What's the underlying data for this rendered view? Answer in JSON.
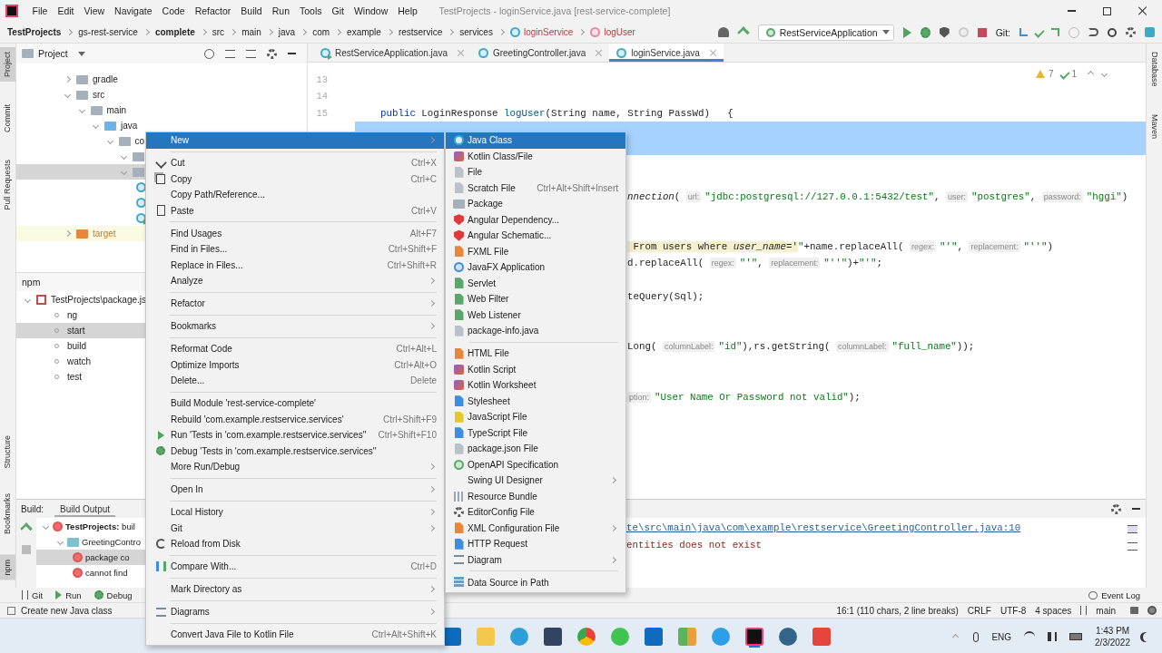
{
  "window": {
    "menu": [
      "File",
      "Edit",
      "View",
      "Navigate",
      "Code",
      "Refactor",
      "Build",
      "Run",
      "Tools",
      "Git",
      "Window",
      "Help"
    ],
    "title": "TestProjects - loginService.java [rest-service-complete]"
  },
  "breadcrumbs": [
    {
      "label": "TestProjects",
      "kind": "project"
    },
    {
      "label": "gs-rest-service",
      "kind": "dir"
    },
    {
      "label": "complete",
      "kind": "module"
    },
    {
      "label": "src",
      "kind": "dir"
    },
    {
      "label": "main",
      "kind": "dir"
    },
    {
      "label": "java",
      "kind": "dir"
    },
    {
      "label": "com",
      "kind": "dir"
    },
    {
      "label": "example",
      "kind": "dir"
    },
    {
      "label": "restservice",
      "kind": "dir"
    },
    {
      "label": "services",
      "kind": "dir"
    },
    {
      "label": "loginService",
      "kind": "class"
    },
    {
      "label": "logUser",
      "kind": "method"
    }
  ],
  "toolbar": {
    "run_config": "RestServiceApplication",
    "git_label": "Git:"
  },
  "left_strip": {
    "top": [
      {
        "label": "Project",
        "selected": true
      },
      {
        "label": "Commit",
        "selected": false
      },
      {
        "label": "Pull Requests",
        "selected": false
      }
    ],
    "bottom": [
      {
        "label": "Structure",
        "selected": false
      },
      {
        "label": "Bookmarks",
        "selected": false
      },
      {
        "label": "npm",
        "selected": true
      }
    ]
  },
  "right_strip": [
    {
      "label": "Database",
      "selected": false
    },
    {
      "label": "Maven",
      "selected": false
    }
  ],
  "project_panel": {
    "title": "Project",
    "tree": [
      {
        "label": "gradle",
        "kind": "folder",
        "expanded": false,
        "selected": false
      },
      {
        "label": "src",
        "kind": "folder",
        "expanded": true,
        "selected": false,
        "children": [
          {
            "label": "main",
            "kind": "folder",
            "expanded": true,
            "selected": false,
            "children": [
              {
                "label": "java",
                "kind": "source",
                "expanded": true,
                "selected": false,
                "children": [
                  {
                    "label": "co",
                    "kind": "folder",
                    "expanded": true,
                    "selected": false,
                    "children": [
                      {
                        "kind": "folder",
                        "expanded": true,
                        "selected": false
                      },
                      {
                        "kind": "folder",
                        "expanded": true,
                        "selected": true,
                        "children": [
                          {
                            "kind": "class",
                            "selected": false
                          },
                          {
                            "kind": "class",
                            "selected": false
                          },
                          {
                            "kind": "runnable",
                            "selected": false
                          }
                        ]
                      }
                    ]
                  }
                ]
              }
            ]
          }
        ]
      },
      {
        "label": "target",
        "kind": "excluded",
        "expanded": false,
        "selected": false
      }
    ]
  },
  "npm_panel": {
    "title": "npm",
    "tree": [
      {
        "label": "TestProjects\\package.js",
        "kind": "package",
        "expanded": true,
        "selected": false,
        "children": [
          {
            "label": "ng",
            "kind": "script",
            "selected": false
          },
          {
            "label": "start",
            "kind": "script",
            "selected": true
          },
          {
            "label": "build",
            "kind": "script",
            "selected": false
          },
          {
            "label": "watch",
            "kind": "script",
            "selected": false
          },
          {
            "label": "test",
            "kind": "script",
            "selected": false
          }
        ]
      }
    ]
  },
  "editor": {
    "tabs": [
      {
        "label": "RestServiceApplication.java",
        "kind": "runnable",
        "selected": false
      },
      {
        "label": "GreetingController.java",
        "kind": "class",
        "selected": false
      },
      {
        "label": "loginService.java",
        "kind": "class",
        "selected": true
      }
    ],
    "inspections": {
      "warnings": "7",
      "weak_warnings": "1"
    },
    "gutter": [
      "13",
      "14",
      "15"
    ],
    "lines": [
      {
        "kind": "blank",
        "selected": false
      },
      {
        "kind": "blank",
        "selected": false
      },
      {
        "kind": "whole",
        "selected": false,
        "segments": [
          {
            "kind": "keyword",
            "text": "public"
          },
          {
            "kind": "plain",
            "text": " LoginResponse "
          },
          {
            "kind": "method",
            "text": "logUser"
          },
          {
            "kind": "plain",
            "text": "(String name, String PassWd)   {"
          }
        ]
      },
      {
        "kind": "tail",
        "selected": true
      },
      {
        "kind": "tail",
        "selected": true
      },
      {
        "kind": "blank",
        "selected": false
      },
      {
        "kind": "blank",
        "selected": false
      },
      {
        "kind": "tail",
        "selected": false,
        "segments": [
          {
            "kind": "static",
            "text": "nnection"
          },
          {
            "kind": "plain",
            "text": "( "
          },
          {
            "kind": "hint",
            "text": "url:"
          },
          {
            "kind": "string",
            "text": "\"jdbc:postgresql://127.0.0.1:5432/test\""
          },
          {
            "kind": "plain",
            "text": ", "
          },
          {
            "kind": "hint",
            "text": "user:"
          },
          {
            "kind": "string",
            "text": "\"postgres\""
          },
          {
            "kind": "plain",
            "text": ", "
          },
          {
            "kind": "hint",
            "text": "password:"
          },
          {
            "kind": "string",
            "text": "\"hggi\""
          },
          {
            "kind": "plain",
            "text": ")"
          }
        ]
      },
      {
        "kind": "blank",
        "selected": false
      },
      {
        "kind": "blank",
        "selected": false
      },
      {
        "kind": "tail",
        "selected": false,
        "segments": [
          {
            "kind": "sql",
            "text": " From users where "
          },
          {
            "kind": "sql-italic",
            "text": "user_name="
          },
          {
            "kind": "sql",
            "text": "'"
          },
          {
            "kind": "string",
            "text": "\""
          },
          {
            "kind": "plain",
            "text": "+name.replaceAll( "
          },
          {
            "kind": "hint",
            "text": "regex:"
          },
          {
            "kind": "string",
            "text": "\"'\""
          },
          {
            "kind": "plain",
            "text": ", "
          },
          {
            "kind": "hint",
            "text": "replacement:"
          },
          {
            "kind": "string",
            "text": "\"''\""
          },
          {
            "kind": "plain",
            "text": ")"
          }
        ]
      },
      {
        "kind": "tail",
        "selected": false,
        "segments": [
          {
            "kind": "plain",
            "text": "d.replaceAll( "
          },
          {
            "kind": "hint",
            "text": "regex:"
          },
          {
            "kind": "string",
            "text": "\"'\""
          },
          {
            "kind": "plain",
            "text": ", "
          },
          {
            "kind": "hint",
            "text": "replacement:"
          },
          {
            "kind": "string",
            "text": "\"''\""
          },
          {
            "kind": "plain",
            "text": ")+"
          },
          {
            "kind": "string",
            "text": "\"'\""
          },
          {
            "kind": "plain",
            "text": ";"
          }
        ]
      },
      {
        "kind": "blank",
        "selected": false
      },
      {
        "kind": "tail",
        "selected": false,
        "segments": [
          {
            "kind": "plain",
            "text": "teQuery(Sql);"
          }
        ]
      },
      {
        "kind": "blank",
        "selected": false
      },
      {
        "kind": "blank",
        "selected": false
      },
      {
        "kind": "tail",
        "selected": false,
        "segments": [
          {
            "kind": "plain",
            "text": "Long( "
          },
          {
            "kind": "hint",
            "text": "columnLabel:"
          },
          {
            "kind": "string",
            "text": "\"id\""
          },
          {
            "kind": "plain",
            "text": "),rs.getString( "
          },
          {
            "kind": "hint",
            "text": "columnLabel:"
          },
          {
            "kind": "string",
            "text": "\"full_name\""
          },
          {
            "kind": "plain",
            "text": "));"
          }
        ]
      },
      {
        "kind": "blank",
        "selected": false
      },
      {
        "kind": "blank",
        "selected": false
      },
      {
        "kind": "tail",
        "selected": false,
        "segments": [
          {
            "kind": "hint",
            "text": "ption:"
          },
          {
            "kind": "string",
            "text": "\"User Name Or Password not valid\""
          },
          {
            "kind": "plain",
            "text": ");"
          }
        ]
      }
    ]
  },
  "build_panel": {
    "label": "Build:",
    "tabs": [
      {
        "label": "Build Output",
        "selected": true
      }
    ],
    "tree": [
      {
        "label": "**TestProjects:** buil",
        "kind": "error",
        "expanded": true,
        "selected": false,
        "children": [
          {
            "label": "GreetingContro",
            "kind": "module",
            "expanded": true,
            "selected": false,
            "children": [
              {
                "label": "package co",
                "kind": "error",
                "selected": true
              },
              {
                "label": "cannot find",
                "kind": "error",
                "selected": false
              }
            ]
          }
        ]
      }
    ],
    "output": [
      {
        "kind": "link",
        "text": "te\\src\\main\\java\\com\\example\\restservice\\GreetingController.java:10"
      },
      {
        "kind": "error",
        "text": "entities does not exist"
      }
    ]
  },
  "bottom_tabs": [
    {
      "label": "Git",
      "kind": "git"
    },
    {
      "label": "Run",
      "kind": "run"
    },
    {
      "label": "Debug",
      "kind": "debug"
    }
  ],
  "event_log": "Event Log",
  "status_bar": {
    "message": "Create new Java class",
    "position": "16:1 (110 chars, 2 line breaks)",
    "line_separator": "CRLF",
    "encoding": "UTF-8",
    "indent": "4 spaces",
    "branch": "main"
  },
  "taskbar": {
    "language": "ENG",
    "time": "1:43 PM",
    "date": "2/3/2022"
  },
  "context_menu": {
    "groups": [
      [
        {
          "label": "New",
          "submenu": true,
          "selected": true
        }
      ],
      [
        {
          "label": "Cut",
          "shortcut": "Ctrl+X",
          "submenu": false,
          "selected": false
        },
        {
          "label": "Copy",
          "shortcut": "Ctrl+C",
          "submenu": false,
          "selected": false
        },
        {
          "label": "Copy Path/Reference...",
          "submenu": false,
          "selected": false
        },
        {
          "label": "Paste",
          "shortcut": "Ctrl+V",
          "submenu": false,
          "selected": false
        }
      ],
      [
        {
          "label": "Find Usages",
          "shortcut": "Alt+F7",
          "submenu": false,
          "selected": false
        },
        {
          "label": "Find in Files...",
          "shortcut": "Ctrl+Shift+F",
          "submenu": false,
          "selected": false
        },
        {
          "label": "Replace in Files...",
          "shortcut": "Ctrl+Shift+R",
          "submenu": false,
          "selected": false
        },
        {
          "label": "Analyze",
          "submenu": true,
          "selected": false
        }
      ],
      [
        {
          "label": "Refactor",
          "submenu": true,
          "selected": false
        }
      ],
      [
        {
          "label": "Bookmarks",
          "submenu": true,
          "selected": false
        }
      ],
      [
        {
          "label": "Reformat Code",
          "shortcut": "Ctrl+Alt+L",
          "submenu": false,
          "selected": false
        },
        {
          "label": "Optimize Imports",
          "shortcut": "Ctrl+Alt+O",
          "submenu": false,
          "selected": false
        },
        {
          "label": "Delete...",
          "shortcut": "Delete",
          "submenu": false,
          "selected": false
        }
      ],
      [
        {
          "label": "Build Module 'rest-service-complete'",
          "submenu": false,
          "selected": false
        },
        {
          "label": "Rebuild 'com.example.restservice.services'",
          "shortcut": "Ctrl+Shift+F9",
          "submenu": false,
          "selected": false
        },
        {
          "label": "Run 'Tests in 'com.example.restservice.services''",
          "shortcut": "Ctrl+Shift+F10",
          "submenu": false,
          "selected": false
        },
        {
          "label": "Debug 'Tests in 'com.example.restservice.services''",
          "submenu": false,
          "selected": false
        },
        {
          "label": "More Run/Debug",
          "submenu": true,
          "selected": false
        }
      ],
      [
        {
          "label": "Open In",
          "submenu": true,
          "selected": false
        }
      ],
      [
        {
          "label": "Local History",
          "submenu": true,
          "selected": false
        },
        {
          "label": "Git",
          "submenu": true,
          "selected": false
        },
        {
          "label": "Reload from Disk",
          "submenu": false,
          "selected": false
        }
      ],
      [
        {
          "label": "Compare With...",
          "shortcut": "Ctrl+D",
          "submenu": false,
          "selected": false
        }
      ],
      [
        {
          "label": "Mark Directory as",
          "submenu": true,
          "selected": false
        }
      ],
      [
        {
          "label": "Diagrams",
          "submenu": true,
          "selected": false
        }
      ],
      [
        {
          "label": "Convert Java File to Kotlin File",
          "shortcut": "Ctrl+Alt+Shift+K",
          "submenu": false,
          "selected": false
        }
      ]
    ]
  },
  "new_submenu": {
    "groups": [
      [
        {
          "label": "Java Class",
          "submenu": false,
          "selected": true
        },
        {
          "label": "Kotlin Class/File",
          "submenu": false,
          "selected": false
        },
        {
          "label": "File",
          "submenu": false,
          "selected": false
        },
        {
          "label": "Scratch File",
          "shortcut": "Ctrl+Alt+Shift+Insert",
          "submenu": false,
          "selected": false
        },
        {
          "label": "Package",
          "submenu": false,
          "selected": false
        },
        {
          "label": "Angular Dependency...",
          "submenu": false,
          "selected": false
        },
        {
          "label": "Angular Schematic...",
          "submenu": false,
          "selected": false
        },
        {
          "label": "FXML File",
          "submenu": false,
          "selected": false
        },
        {
          "label": "JavaFX Application",
          "submenu": false,
          "selected": false
        },
        {
          "label": "Servlet",
          "submenu": false,
          "selected": false
        },
        {
          "label": "Web Filter",
          "submenu": false,
          "selected": false
        },
        {
          "label": "Web Listener",
          "submenu": false,
          "selected": false
        },
        {
          "label": "package-info.java",
          "submenu": false,
          "selected": false
        }
      ],
      [
        {
          "label": "HTML File",
          "submenu": false,
          "selected": false
        },
        {
          "label": "Kotlin Script",
          "submenu": false,
          "selected": false
        },
        {
          "label": "Kotlin Worksheet",
          "submenu": false,
          "selected": false
        },
        {
          "label": "Stylesheet",
          "submenu": false,
          "selected": false
        },
        {
          "label": "JavaScript File",
          "submenu": false,
          "selected": false
        },
        {
          "label": "TypeScript File",
          "submenu": false,
          "selected": false
        },
        {
          "label": "package.json File",
          "submenu": false,
          "selected": false
        },
        {
          "label": "OpenAPI Specification",
          "submenu": false,
          "selected": false
        },
        {
          "label": "Swing UI Designer",
          "submenu": true,
          "selected": false
        },
        {
          "label": "Resource Bundle",
          "submenu": false,
          "selected": false
        },
        {
          "label": "EditorConfig File",
          "submenu": false,
          "selected": false
        },
        {
          "label": "XML Configuration File",
          "submenu": true,
          "selected": false
        },
        {
          "label": "HTTP Request",
          "submenu": false,
          "selected": false
        },
        {
          "label": "Diagram",
          "submenu": true,
          "selected": false
        }
      ],
      [
        {
          "label": "Data Source in Path",
          "submenu": false,
          "selected": false
        }
      ]
    ]
  }
}
